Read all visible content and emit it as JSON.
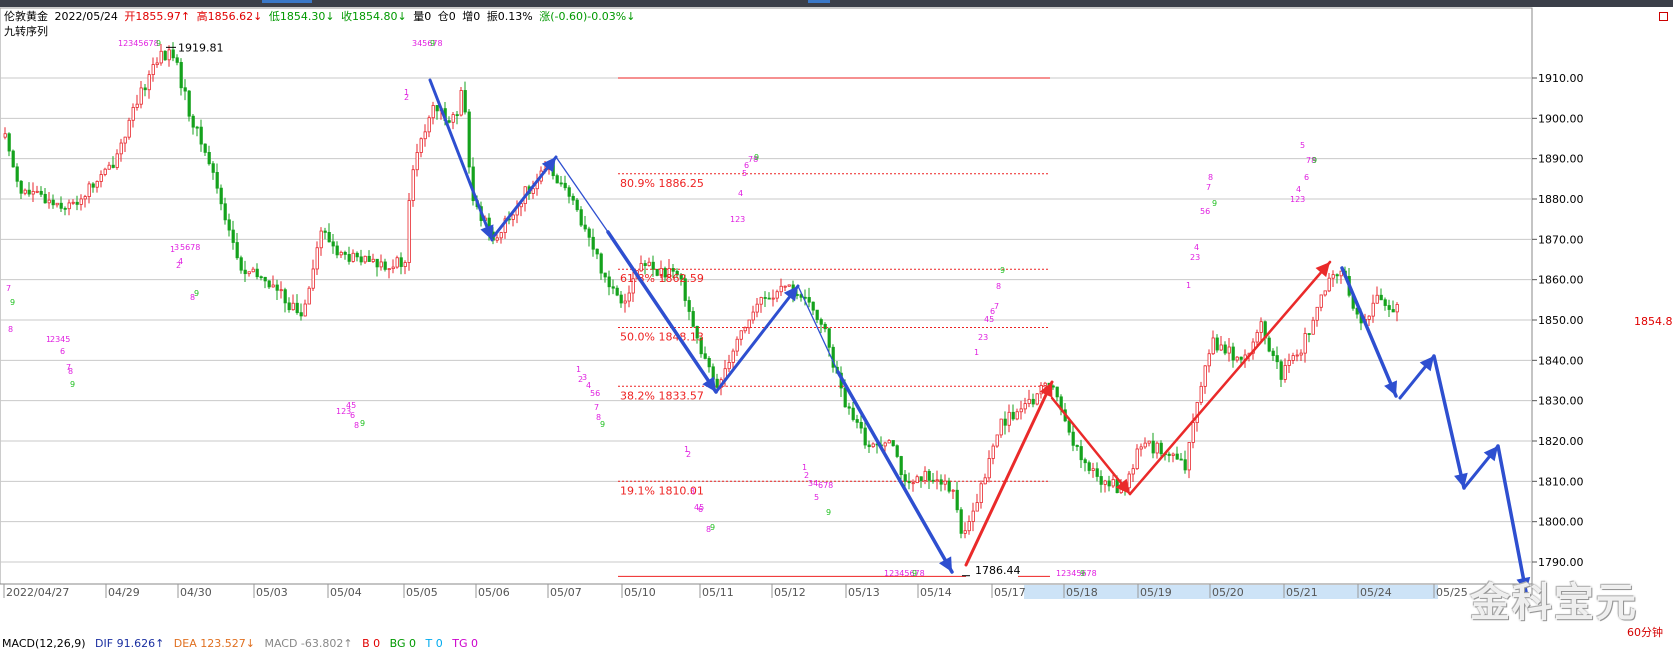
{
  "header": {
    "symbol": "伦敦黄金",
    "date": "2022/05/24",
    "open": "开1855.97↑",
    "high": "高1856.62↓",
    "low": "低1854.30↓",
    "close": "收1854.80↓",
    "volume": "量0",
    "position": "仓0",
    "increase": "增0",
    "amplitude": "振0.13%",
    "change": "涨(-0.60)-0.03%↓",
    "indicator": "九转序列"
  },
  "colors": {
    "up": "#e8262c",
    "down": "#15a21d",
    "blue_arrow": "#2e4fd0",
    "red_arrow": "#ea2a2a",
    "fib": "#ee2222",
    "grid": "#c9c9c9",
    "td_magenta": "#e020e0",
    "td_green": "#20c020",
    "axis_bg": "#f0f0f0",
    "highlight_axis": "#cde3f7"
  },
  "price_axis": {
    "labels": [
      "1910.00",
      "1900.00",
      "1890.00",
      "1880.00",
      "1870.00",
      "1860.00",
      "1850.00",
      "1840.00",
      "1830.00",
      "1820.00",
      "1810.00",
      "1800.00",
      "1790.00"
    ],
    "current": "1854.80"
  },
  "time_axis": [
    "2022/04/27",
    "04/29",
    "04/30",
    "05/03",
    "05/04",
    "05/05",
    "05/06",
    "05/07",
    "05/10",
    "05/11",
    "05/12",
    "05/13",
    "05/14",
    "05/17",
    "05/18",
    "05/19",
    "05/20",
    "05/21",
    "05/24",
    "05/25"
  ],
  "annotations": {
    "high_label": "1919.81",
    "low_label": "1786.44",
    "fib_809": "80.9% 1886.25",
    "fib_618": "61.8% 1862.59",
    "fib_500": "50.0% 1848.13",
    "fib_382": "38.2% 1833.57",
    "fib_191": "19.1% 1810.01"
  },
  "td_sequences": [
    {
      "text": "123456789",
      "color": "magenta"
    },
    {
      "text": "2",
      "color": "magenta"
    },
    {
      "text": "1",
      "color": "magenta"
    },
    {
      "text": "9",
      "color": "green"
    }
  ],
  "macd": {
    "name": "MACD(12,26,9)",
    "dif": "DIF 91.626↑",
    "dea": "DEA 123.527↓",
    "macd": "MACD -63.802↑",
    "b": "B 0",
    "bg": "BG 0",
    "t": "T 0",
    "tg": "TG 0"
  },
  "period": "60分钟",
  "watermark": "金科宝元"
}
